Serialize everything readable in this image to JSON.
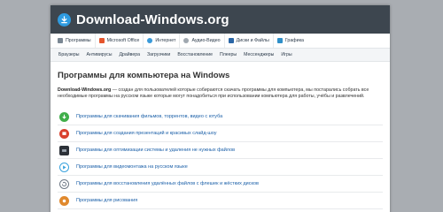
{
  "header": {
    "title": "Download-Windows.org"
  },
  "nav_primary": [
    {
      "label": "Программы",
      "icon": "home-icon",
      "color": "#7a8793"
    },
    {
      "label": "Microsoft Office",
      "icon": "office-icon",
      "color": "#e5552c"
    },
    {
      "label": "Интернет",
      "icon": "globe-icon",
      "color": "#3a9ad9"
    },
    {
      "label": "Аудио-Видео",
      "icon": "media-icon",
      "color": "#a0a8b0"
    },
    {
      "label": "Диски и Файлы",
      "icon": "disk-icon",
      "color": "#2a66a6"
    },
    {
      "label": "Графика",
      "icon": "graphics-icon",
      "color": "#2f8fc8"
    }
  ],
  "nav_secondary": [
    "Браузеры",
    "Антивирусы",
    "Драйвера",
    "Загрузчики",
    "Восстановление",
    "Плееры",
    "Мессенджеры",
    "Игры"
  ],
  "main": {
    "title": "Программы для компьютера на Windows",
    "intro_brand": "Download-Windows.org",
    "intro_text": " — создан для пользователей которые собираются скачать программы для компьютера, мы постарались собрать все необходимые программы на русском языке которые могут понадобиться при использовании компьютера для работы, учёбы и развлечений.",
    "list": [
      {
        "label": "Программы для скачивания фильмов, торрентов, видео с ютуба",
        "icon": "torrent-icon",
        "color": "#3fae49"
      },
      {
        "label": "Программы для создания презентаций и красивых слайд-шоу",
        "icon": "presentation-icon",
        "color": "#d9412e"
      },
      {
        "label": "Программы для оптимизации системы и удаления не нужных файлов",
        "icon": "optimizer-icon",
        "color": "#2c3138"
      },
      {
        "label": "Программы для видеомонтажа на русском языке",
        "icon": "video-icon",
        "color": "#3aa3dd"
      },
      {
        "label": "Программы для восстановления удалённых файлов с флешек и жёстких дисков",
        "icon": "recovery-icon",
        "color": "#6f7a86"
      },
      {
        "label": "Программы для рисования",
        "icon": "drawing-icon",
        "color": "#e0892d"
      }
    ]
  }
}
